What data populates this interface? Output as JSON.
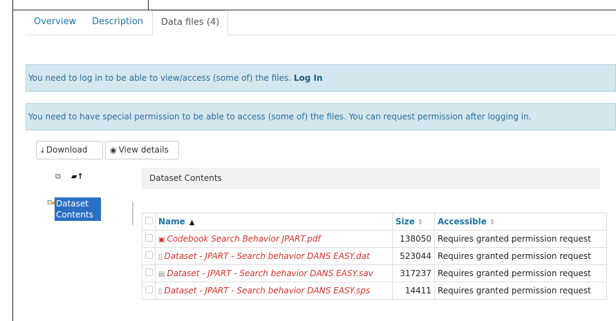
{
  "tabs": [
    {
      "label": "Overview"
    },
    {
      "label": "Description"
    },
    {
      "label": "Data files (4)"
    }
  ],
  "alerts": {
    "login": {
      "text": "You need to log in to be able to view/access (some of) the files.",
      "link": "Log In"
    },
    "permission": {
      "text": "You need to have special permission to be able to access (some of) the files. You can request permission after logging in."
    }
  },
  "toolbar": {
    "download_label": "Download",
    "details_label": "View details"
  },
  "tree": {
    "node_label": "Dataset Contents"
  },
  "content": {
    "heading": "Dataset Contents"
  },
  "table": {
    "headers": {
      "name": "Name",
      "size": "Size",
      "accessible": "Accessible"
    },
    "rows": [
      {
        "name": "Codebook Search Behavior JPART.pdf",
        "size": "138050",
        "accessible": "Requires granted permission request",
        "icon": "pdf-icon"
      },
      {
        "name": "Dataset - JPART - Search behavior DANS EASY.dat",
        "size": "523044",
        "accessible": "Requires granted permission request",
        "icon": "file-icon"
      },
      {
        "name": "Dataset - JPART - Search behavior DANS EASY.sav",
        "size": "317237",
        "accessible": "Requires granted permission request",
        "icon": "data-file-icon"
      },
      {
        "name": "Dataset - JPART - Search behavior DANS EASY.sps",
        "size": "14411",
        "accessible": "Requires granted permission request",
        "icon": "file-icon"
      }
    ]
  },
  "colors": {
    "link": "#1a73a8",
    "alert_bg": "#d4e6ee",
    "restricted_file": "#d9302b",
    "tree_selected": "#2a6fc4"
  }
}
